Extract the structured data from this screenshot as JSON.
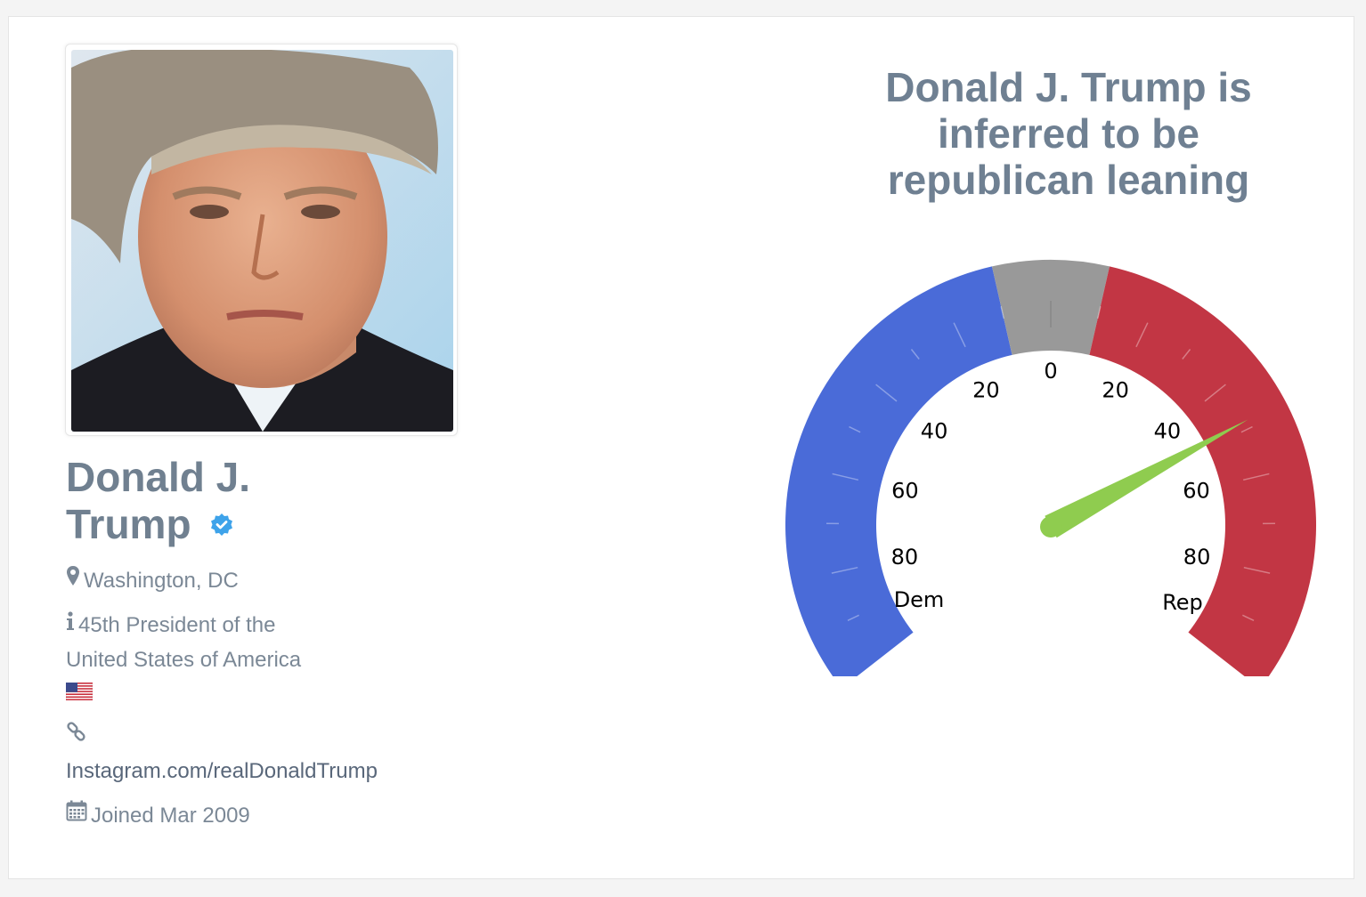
{
  "profile": {
    "name": "Donald J. Trump",
    "verified": true,
    "location": "Washington, DC",
    "bio_line1": "45th President of the",
    "bio_line2": "United States of America",
    "website": "Instagram.com/realDonaldTrump",
    "joined": "Joined Mar 2009",
    "icons": {
      "location": "map-marker-icon",
      "bio": "info-icon",
      "website": "link-icon",
      "joined": "calendar-icon",
      "verified": "verified-badge-icon",
      "flag": "us-flag-icon"
    }
  },
  "gauge": {
    "title": "Donald J. Trump is inferred to be republican leaning",
    "left_label": "Dem",
    "right_label": "Rep",
    "center_label": "0",
    "tick_labels_left": [
      "20",
      "40",
      "60",
      "80"
    ],
    "tick_labels_right": [
      "20",
      "40",
      "60",
      "80"
    ],
    "value": 48,
    "value_side": "Rep",
    "colors": {
      "dem": "#4a6bd8",
      "neutral": "#999999",
      "rep": "#c23644",
      "needle": "#8fcc4f"
    }
  }
}
